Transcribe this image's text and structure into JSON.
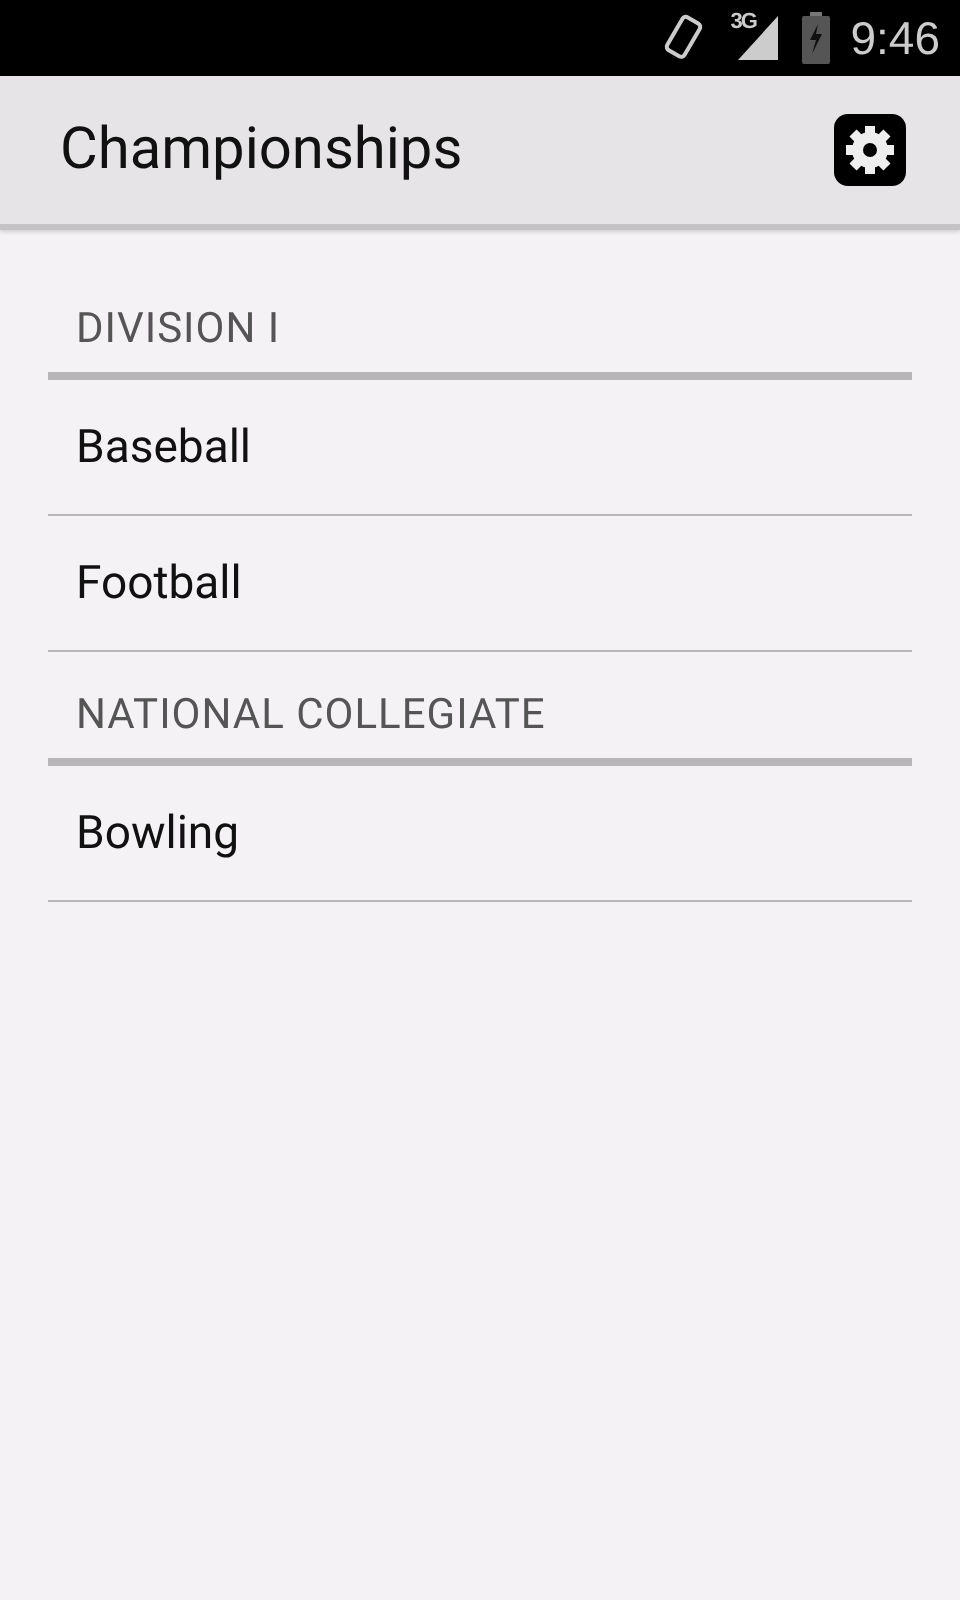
{
  "status_bar": {
    "network": "3G",
    "time": "9:46"
  },
  "app_bar": {
    "title": "Championships"
  },
  "sections": [
    {
      "header": "DIVISION I",
      "items": [
        "Baseball",
        "Football"
      ]
    },
    {
      "header": "NATIONAL COLLEGIATE",
      "items": [
        "Bowling"
      ]
    }
  ]
}
